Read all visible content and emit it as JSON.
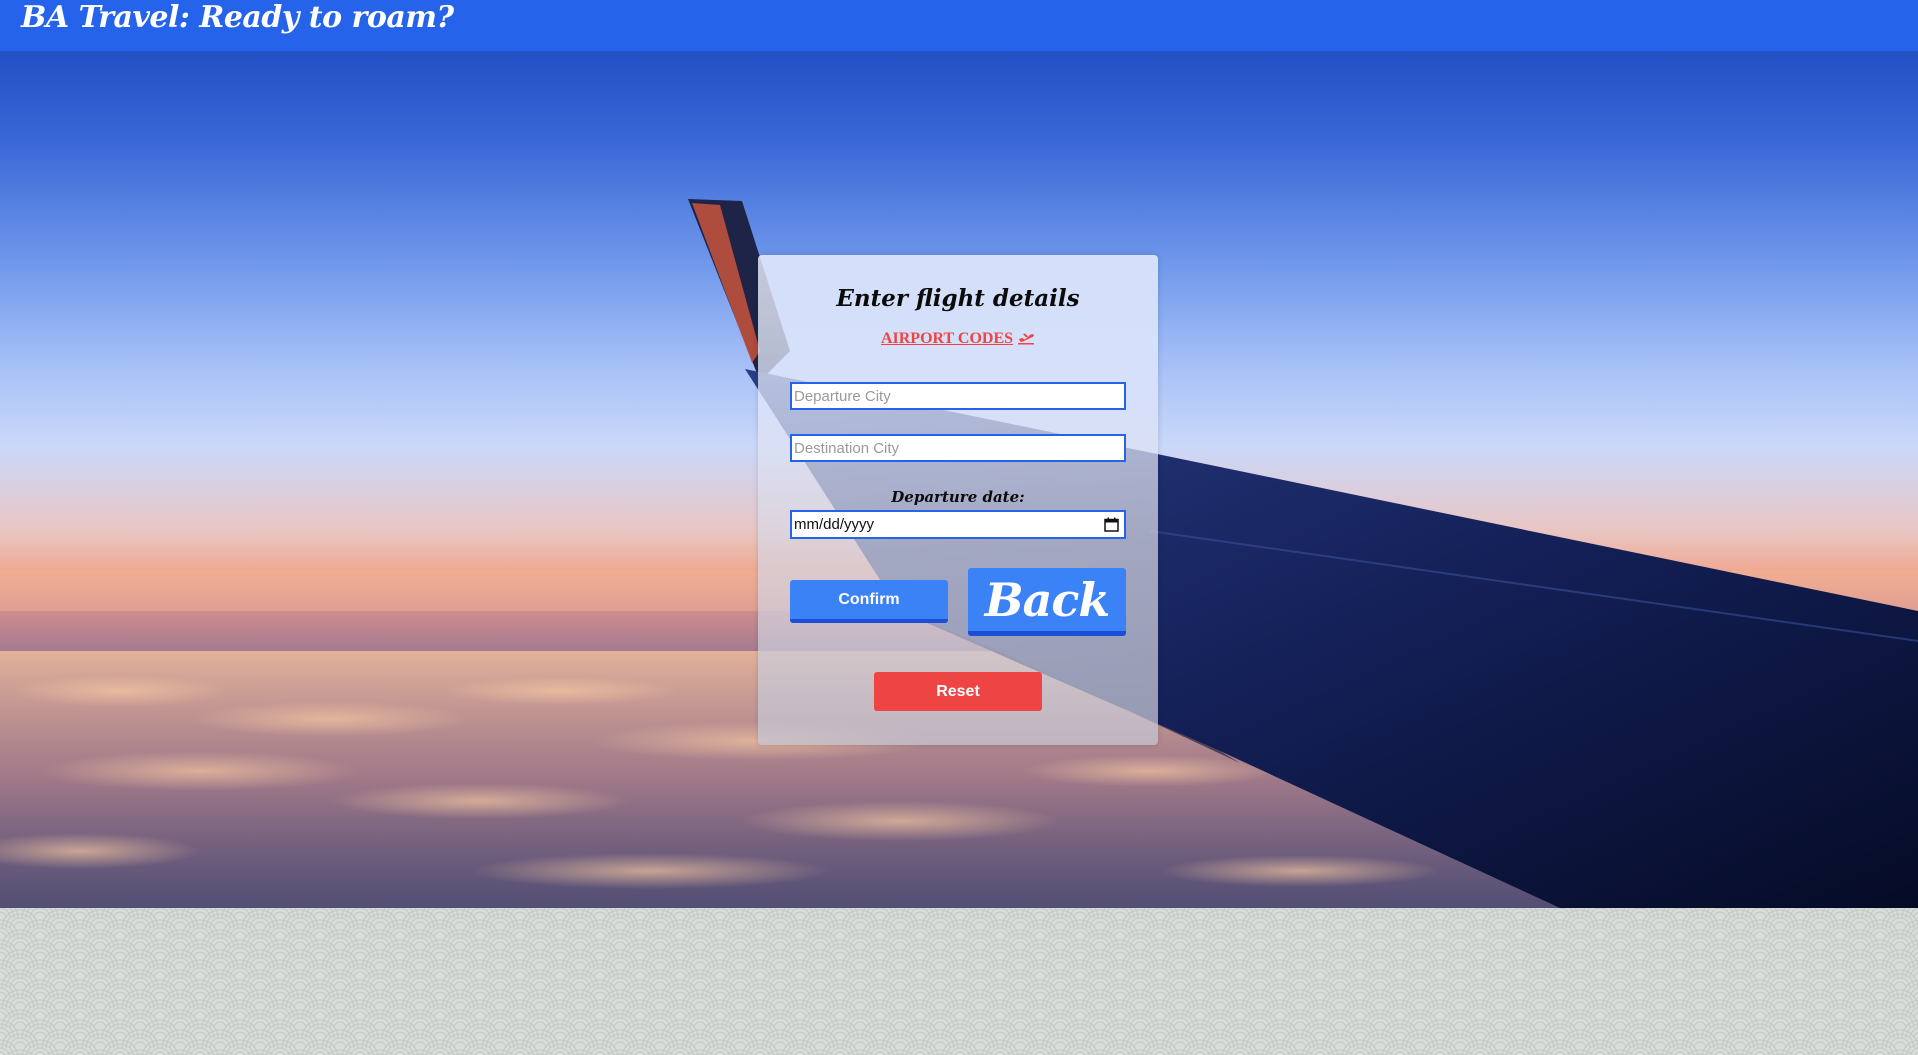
{
  "header": {
    "title": "BA Travel: Ready to roam?"
  },
  "form": {
    "title": "Enter flight details",
    "airport_codes_link": "AIRPORT CODES",
    "link_icon": "plane-departure-icon",
    "departure_placeholder": "Departure City",
    "departure_value": "",
    "destination_placeholder": "Destination City",
    "destination_value": "",
    "date_label": "Departure date:",
    "date_value": "mm/dd/yyyy",
    "date_icon": "calendar-icon",
    "confirm_label": "Confirm",
    "back_label": "Back",
    "reset_label": "Reset"
  },
  "colors": {
    "header_bg": "#2563eb",
    "primary_button": "#3b82f6",
    "reset_button": "#ef4444",
    "link": "#ef4444",
    "input_border": "#2563eb"
  }
}
